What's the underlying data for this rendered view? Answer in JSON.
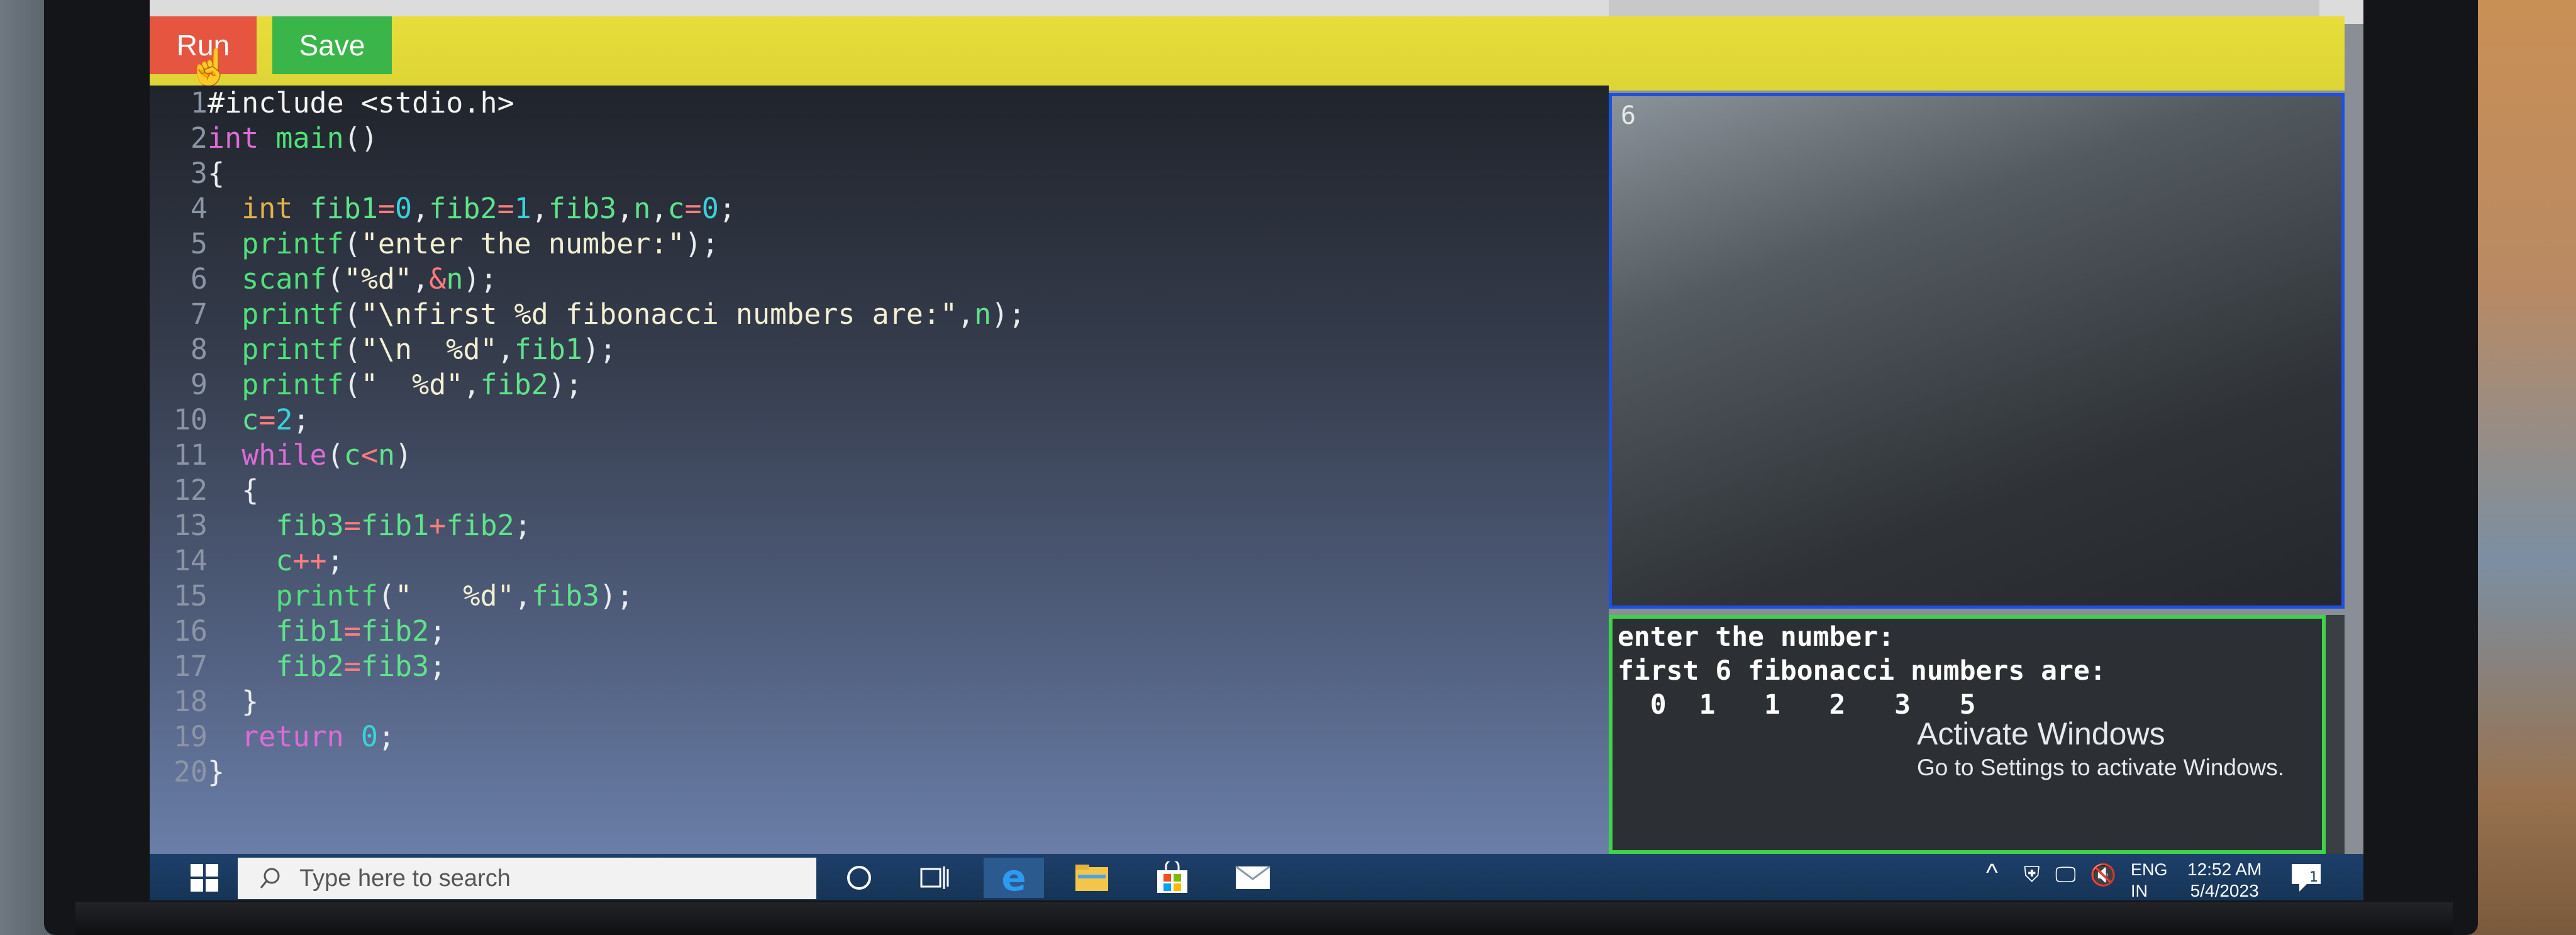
{
  "toolbar": {
    "run_label": "Run",
    "save_label": "Save"
  },
  "editor": {
    "line_numbers": [
      "1",
      "2",
      "3",
      "4",
      "5",
      "6",
      "7",
      "8",
      "9",
      "10",
      "11",
      "12",
      "13",
      "14",
      "15",
      "16",
      "17",
      "18",
      "19",
      "20"
    ]
  },
  "input_panel": {
    "value": "6"
  },
  "output_panel": {
    "lines": [
      "enter the number:",
      "first 6 fibonacci numbers are:",
      "  0  1   1   2   3   5"
    ]
  },
  "watermark": {
    "title": "Activate Windows",
    "subtitle": "Go to Settings to activate Windows."
  },
  "taskbar": {
    "search_placeholder": "Type here to search",
    "lang": "ENG",
    "region": "IN",
    "time": "12:52 AM",
    "date": "5/4/2023",
    "notification_count": "1"
  },
  "colors": {
    "run_button": "#e6553f",
    "save_button": "#39b54a",
    "toolbar": "#e2d838",
    "input_border": "#1f4fe0",
    "output_border": "#3fd24a"
  }
}
